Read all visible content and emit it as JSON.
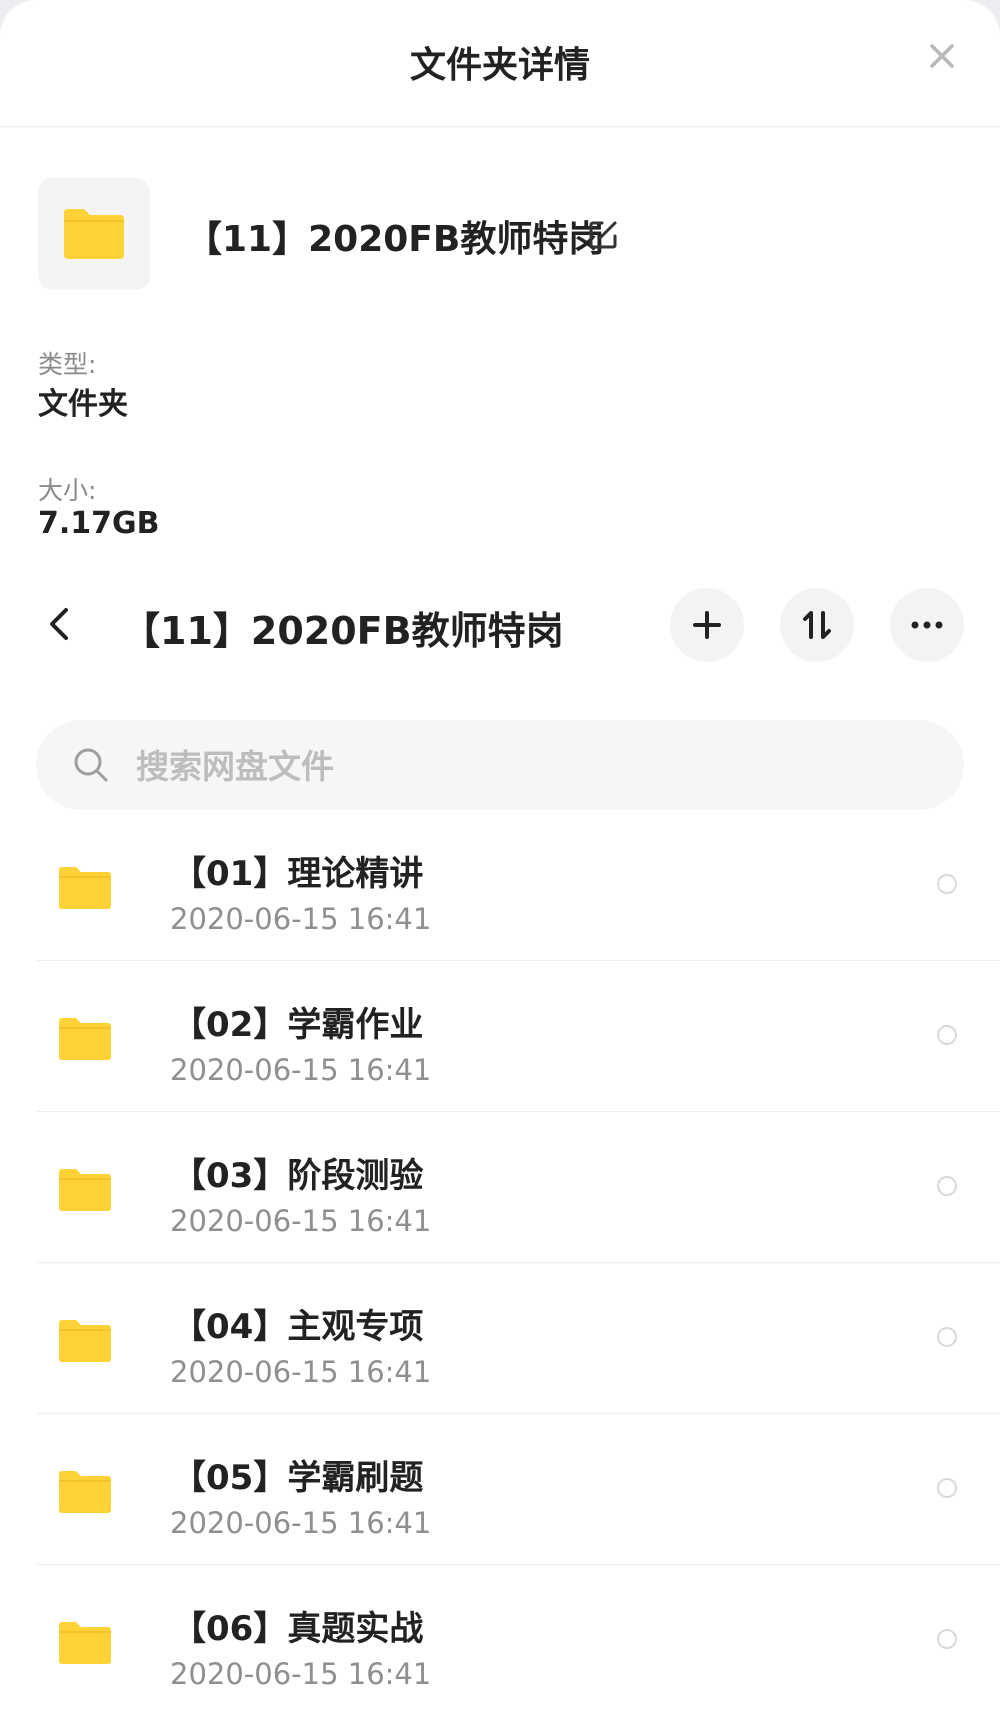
{
  "header": {
    "title": "文件夹详情",
    "close_icon": "close-icon"
  },
  "folder": {
    "name": "【11】2020FB教师特岗",
    "icon": "folder-icon",
    "edit_icon": "edit-icon",
    "icon_color": "#FFD338"
  },
  "properties": {
    "type_label": "类型:",
    "type_value": "文件夹",
    "size_label": "大小:",
    "size_value": "7.17GB"
  },
  "navbar": {
    "title": "【11】2020FB教师特岗",
    "back_icon": "back-arrow-icon",
    "actions": [
      "add-icon",
      "sort-icon",
      "more-icon"
    ]
  },
  "search": {
    "placeholder": "搜索网盘文件",
    "value": "",
    "icon": "search-icon"
  },
  "items": [
    {
      "name": "【01】理论精讲",
      "date": "2020-06-15  16:41"
    },
    {
      "name": "【02】学霸作业",
      "date": "2020-06-15  16:41"
    },
    {
      "name": "【03】阶段测验",
      "date": "2020-06-15  16:41"
    },
    {
      "name": "【04】主观专项",
      "date": "2020-06-15  16:41"
    },
    {
      "name": "【05】学霸刷题",
      "date": "2020-06-15  16:41"
    },
    {
      "name": "【06】真题实战",
      "date": "2020-06-15  16:41"
    }
  ],
  "colors": {
    "accent_folder": "#FFD338",
    "text_primary": "#222222",
    "text_secondary": "#8F8F8F"
  }
}
